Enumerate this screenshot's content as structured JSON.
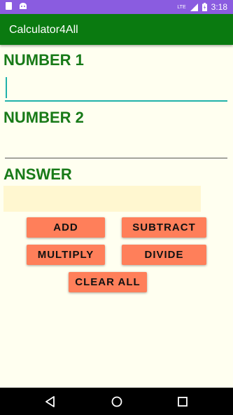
{
  "status_bar": {
    "time": "3:18",
    "network": "LTE",
    "left_icons": [
      "sd-card-icon",
      "android-icon"
    ]
  },
  "app_bar": {
    "title": "Calculator4All"
  },
  "form": {
    "number1_label": "NUMBER 1",
    "number1_value": "",
    "number2_label": "NUMBER 2",
    "number2_value": "",
    "answer_label": "ANSWER",
    "answer_value": ""
  },
  "buttons": {
    "add": "ADD",
    "subtract": "SUBTRACT",
    "multiply": "MULTIPLY",
    "divide": "DIVIDE",
    "clear_all": "CLEAR ALL"
  },
  "colors": {
    "status_bar": "#8a5ce0",
    "app_bar": "#0a7a10",
    "label": "#187a18",
    "button": "#ff7f5a",
    "answer_box": "#fff7d0",
    "background": "#fffff0"
  },
  "nav_bar": {
    "icons": [
      "back-icon",
      "home-icon",
      "recents-icon"
    ]
  }
}
